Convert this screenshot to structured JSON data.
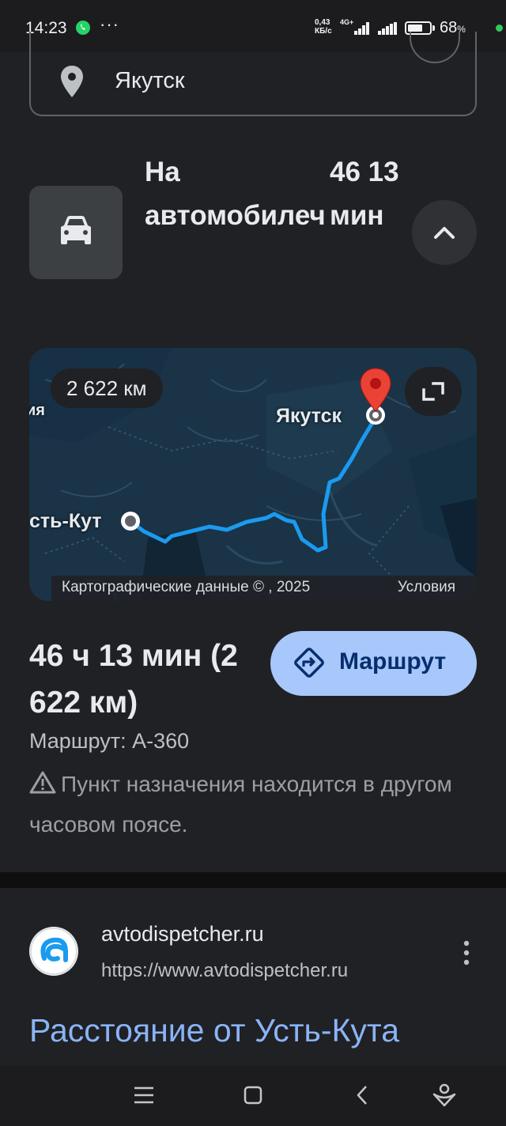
{
  "status_bar": {
    "time": "14:23",
    "dots": "···",
    "speed_value": "0,43",
    "speed_unit": "КБ/с",
    "network_type": "4G+",
    "battery_percent": "68",
    "battery_percent_sign": "%",
    "battery_level": 0.68,
    "notification_icon": "whatsapp-icon"
  },
  "destination": {
    "value": "Якутск",
    "icon": "location-pin-icon"
  },
  "travel_mode": {
    "label": "На автомобилеч",
    "time": "46 13 мин",
    "icon": "car-icon",
    "collapse_icon": "chevron-up-icon"
  },
  "map": {
    "distance": "2 622 км",
    "origin_label": "сть-Кут",
    "destination_label": "Якутск",
    "edge_label": "ия",
    "copyright": "Картографические данные © , 2025",
    "terms": "Условия",
    "route_color": "#1a9bf0",
    "pin_color": "#ea4335"
  },
  "summary": {
    "duration_distance": "46 ч 13 мин (2 622 км)",
    "route_button": "Маршрут",
    "route_via": "Маршрут: А-360",
    "warning": "Пункт назначения находится в другом часовом поясе."
  },
  "search_result": {
    "site_name": "avtodispetcher.ru",
    "url": "https://www.avtodispetcher.ru",
    "title": "Расстояние от Усть-Кута"
  }
}
